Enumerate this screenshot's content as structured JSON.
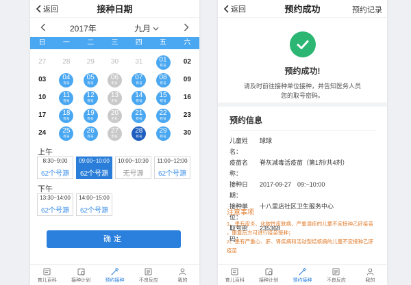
{
  "left": {
    "nav": {
      "back": "返回",
      "title": "接种日期"
    },
    "month_bar": {
      "year": "2017年",
      "month": "九月"
    },
    "weekdays": [
      "日",
      "一",
      "二",
      "三",
      "四",
      "五",
      "六"
    ],
    "calendar": [
      [
        {
          "d": "27",
          "s": "faded"
        },
        {
          "d": "28",
          "s": "faded"
        },
        {
          "d": "29",
          "s": "faded"
        },
        {
          "d": "30",
          "s": "faded"
        },
        {
          "d": "31",
          "s": "faded"
        },
        {
          "d": "01",
          "s": "avail",
          "sub": "有号"
        },
        {
          "d": "02",
          "s": "plain"
        }
      ],
      [
        {
          "d": "03",
          "s": "plain"
        },
        {
          "d": "04",
          "s": "avail",
          "sub": "有号"
        },
        {
          "d": "05",
          "s": "avail",
          "sub": "有号"
        },
        {
          "d": "06",
          "s": "full",
          "sub": "无号"
        },
        {
          "d": "07",
          "s": "avail",
          "sub": "有号"
        },
        {
          "d": "08",
          "s": "avail",
          "sub": "有号"
        },
        {
          "d": "09",
          "s": "plain"
        }
      ],
      [
        {
          "d": "10",
          "s": "plain"
        },
        {
          "d": "11",
          "s": "avail",
          "sub": "有号"
        },
        {
          "d": "12",
          "s": "avail",
          "sub": "有号"
        },
        {
          "d": "13",
          "s": "full",
          "sub": "无号"
        },
        {
          "d": "14",
          "s": "avail",
          "sub": "有号"
        },
        {
          "d": "15",
          "s": "avail",
          "sub": "有号"
        },
        {
          "d": "16",
          "s": "plain"
        }
      ],
      [
        {
          "d": "17",
          "s": "plain"
        },
        {
          "d": "18",
          "s": "avail",
          "sub": "有号"
        },
        {
          "d": "19",
          "s": "avail",
          "sub": "有号"
        },
        {
          "d": "20",
          "s": "full",
          "sub": "无号"
        },
        {
          "d": "21",
          "s": "avail",
          "sub": "有号"
        },
        {
          "d": "22",
          "s": "avail",
          "sub": "有号"
        },
        {
          "d": "23",
          "s": "plain"
        }
      ],
      [
        {
          "d": "24",
          "s": "plain"
        },
        {
          "d": "25",
          "s": "avail",
          "sub": "有号"
        },
        {
          "d": "26",
          "s": "avail",
          "sub": "有号"
        },
        {
          "d": "27",
          "s": "full",
          "sub": "无号"
        },
        {
          "d": "28",
          "s": "sel",
          "sub": "有号"
        },
        {
          "d": "29",
          "s": "avail",
          "sub": "有号"
        },
        {
          "d": "30",
          "s": "plain"
        }
      ]
    ],
    "morning": {
      "label": "上午",
      "slots": [
        {
          "time": "8:30~9:00",
          "count": "62个号源",
          "state": "normal"
        },
        {
          "time": "09:00~10:00",
          "count": "62个号源",
          "state": "selected"
        },
        {
          "time": "10:00~10:30",
          "count": "无号源",
          "state": "none"
        },
        {
          "time": "11:00~12:00",
          "count": "62个号源",
          "state": "normal"
        }
      ]
    },
    "afternoon": {
      "label": "下午",
      "slots": [
        {
          "time": "13:30~14:00",
          "count": "62个号源",
          "state": "normal"
        },
        {
          "time": "14:00~15:00",
          "count": "62个号源",
          "state": "normal"
        }
      ]
    },
    "confirm": "确定"
  },
  "right": {
    "nav": {
      "back": "返回",
      "title": "预约成功",
      "records": "预约记录"
    },
    "success": {
      "title": "预约成功!",
      "msg1": "请及时前往接种单位接种，并告知医务人员",
      "msg2": "您的取号密码。"
    },
    "info": {
      "title": "预约信息",
      "rows": [
        {
          "k": "儿童姓名：",
          "v": "球球"
        },
        {
          "k": "疫苗名称：",
          "v": "脊灰减毒活疫苗（第1剂/共4剂）"
        },
        {
          "k": "接种日期：",
          "v": "2017-09-27　09:~10:00"
        },
        {
          "k": "接种单位：",
          "v": "十八里店社区卫生服务中心"
        },
        {
          "k": "取号密码：",
          "v": "235368"
        }
      ]
    },
    "notes": {
      "title": "注意事项",
      "lines": [
        "1、患有皮炎、化脓性皮肤病、严重湿疹的儿童不宜接种乙肝疫苗",
        "，康复后方可进行疫苗接种；",
        "2、患有严重心、肝、肾疾病和活动型结核病的儿童不宜接种乙肝",
        "疫苗"
      ]
    }
  },
  "tabs": [
    "育儿百科",
    "接种计划",
    "预约接种",
    "不良反应",
    "我的"
  ],
  "active_tab": 2,
  "colors": {
    "accent": "#4aa7f1",
    "selected_day": "#1e5fbf",
    "button": "#2b80dd",
    "success": "#2bb673",
    "warning": "#e07b2b"
  }
}
